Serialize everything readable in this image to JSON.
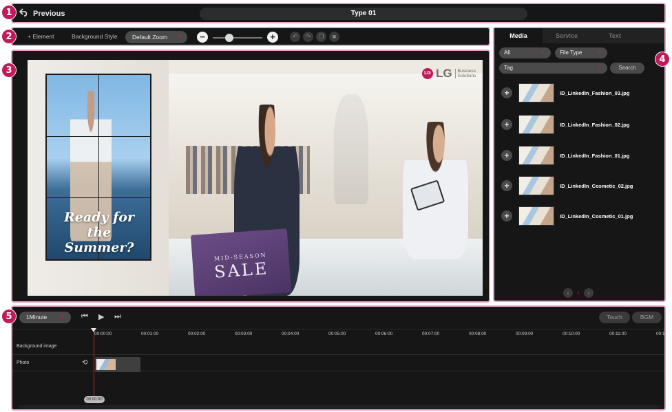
{
  "badges": [
    "1",
    "2",
    "3",
    "4",
    "5"
  ],
  "header": {
    "back_label": "Previous",
    "title": "Type 01"
  },
  "toolbar": {
    "element_label": "+ Element",
    "background_style_label": "Background Style",
    "zoom_value": "Default Zoom",
    "zoom_level": 0.3,
    "zoom_out_icon": "minus",
    "zoom_in_icon": "plus"
  },
  "canvas": {
    "videowall_text": "Ready for the Summer?",
    "bag_line1": "MID-SEASON",
    "bag_line2": "SALE",
    "logo": {
      "brand": "LG",
      "sub1": "Business",
      "sub2": "Solutions"
    }
  },
  "media_panel": {
    "tabs": [
      {
        "label": "Media",
        "active": true
      },
      {
        "label": "Service",
        "active": false
      },
      {
        "label": "Text",
        "active": false
      }
    ],
    "filter_all": "All",
    "filter_file_type": "File Type",
    "filter_tag": "Tag",
    "search_label": "Search",
    "items": [
      {
        "name": "ID_LinkedIn_Fashion_03.jpg"
      },
      {
        "name": "ID_LinkedIn_Fashion_02.jpg"
      },
      {
        "name": "ID_LinkedIn_Fashion_01.jpg"
      },
      {
        "name": "ID_LinkedIn_Cosmetic_02.jpg"
      },
      {
        "name": "ID_LinkedIn_Cosmetic_01.jpg"
      }
    ],
    "page": "1"
  },
  "timeline": {
    "duration": "1Minute",
    "touch_label": "Touch",
    "bgm_label": "BGM",
    "ticks": [
      "00:00:00",
      "00:01:00",
      "00:02:00",
      "00:03:00",
      "00:04:00",
      "00:05:00",
      "00:06:00",
      "00:07:00",
      "00:08:00",
      "00:09:00",
      "00:10:00",
      "00:11:00",
      "00:1"
    ],
    "tracks": [
      {
        "label": "Background image"
      },
      {
        "label": "Photo"
      }
    ],
    "playhead_time": "00:00:00"
  },
  "colors": {
    "accent": "#c01a5a",
    "panel_bg": "#161616",
    "outline": "#e8a0c4"
  }
}
